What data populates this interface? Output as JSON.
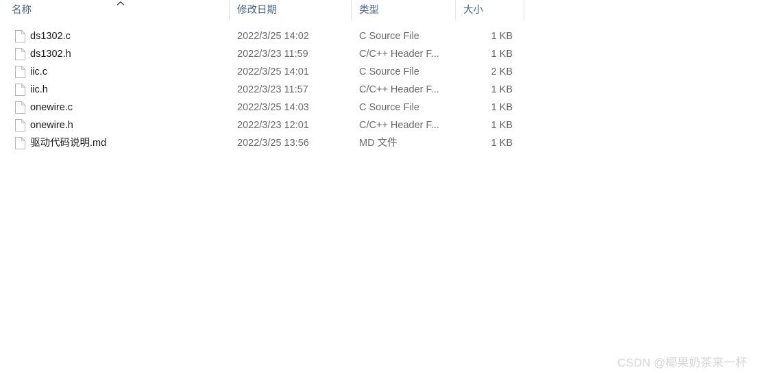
{
  "header": {
    "columns": [
      {
        "id": "name",
        "label": "名称"
      },
      {
        "id": "date",
        "label": "修改日期"
      },
      {
        "id": "type",
        "label": "类型"
      },
      {
        "id": "size",
        "label": "大小"
      }
    ],
    "sort": {
      "column": "名称",
      "direction": "ascending",
      "icon": "chevron-up-icon"
    }
  },
  "files": [
    {
      "name": "ds1302.c",
      "date": "2022/3/25 14:02",
      "type": "C Source File",
      "size": "1 KB",
      "icon": "file-icon"
    },
    {
      "name": "ds1302.h",
      "date": "2022/3/23 11:59",
      "type": "C/C++ Header F...",
      "size": "1 KB",
      "icon": "file-icon"
    },
    {
      "name": "iic.c",
      "date": "2022/3/25 14:01",
      "type": "C Source File",
      "size": "2 KB",
      "icon": "file-icon"
    },
    {
      "name": "iic.h",
      "date": "2022/3/23 11:57",
      "type": "C/C++ Header F...",
      "size": "1 KB",
      "icon": "file-icon"
    },
    {
      "name": "onewire.c",
      "date": "2022/3/25 14:03",
      "type": "C Source File",
      "size": "1 KB",
      "icon": "file-icon"
    },
    {
      "name": "onewire.h",
      "date": "2022/3/23 12:01",
      "type": "C/C++ Header F...",
      "size": "1 KB",
      "icon": "file-icon"
    },
    {
      "name": "驱动代码说明.md",
      "date": "2022/3/25 13:56",
      "type": "MD 文件",
      "size": "1 KB",
      "icon": "file-icon"
    }
  ],
  "watermark": {
    "text": "CSDN @椰果奶茶来一杯"
  },
  "colors": {
    "background": "#ffffff",
    "header_text": "#4a6288",
    "filename_text": "#1a1a1a",
    "secondary_text": "#6b6b6b",
    "divider": "#e2e2e2",
    "icon_outline": "#b4b4b4",
    "watermark_text": "#d6d6d6"
  }
}
